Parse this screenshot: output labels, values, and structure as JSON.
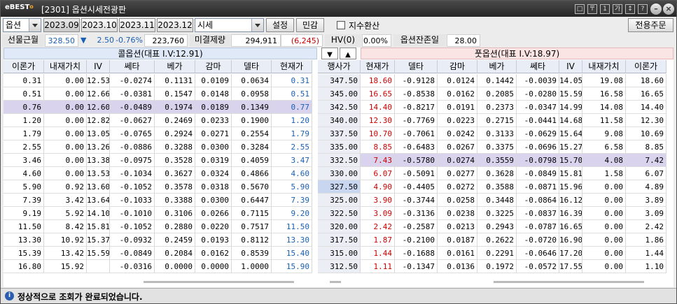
{
  "window": {
    "logo": "eBEST",
    "logo_mark": "o",
    "title": "[2301] 옵션시세전광판"
  },
  "title_buttons": [
    "□",
    "〒",
    "1",
    "가",
    "↕",
    "?"
  ],
  "toolbar": {
    "product_value": "옵션",
    "months": [
      "2023.09",
      "2023.10",
      "2023.11",
      "2023.12"
    ],
    "selected_month": "2023.09",
    "type_value": "시세",
    "settings_label": "설정",
    "sensitivity_label": "민감",
    "index_convert_label": "지수환산",
    "index_convert_checked": false,
    "order_label": "전용주문"
  },
  "info": {
    "futures_label": "선물근월",
    "futures_price": "328.50",
    "futures_arrow": "▼",
    "futures_change": "2.50",
    "futures_rate": "-0.76%",
    "futures_volume": "223,760",
    "oi_label": "미결제량",
    "oi_value": "294,911",
    "oi_change": "(6,245)",
    "hv_label": "HV(0)",
    "hv_value": "0.00%",
    "days_label": "옵션잔존일",
    "days_value": "28.00"
  },
  "colors": {
    "call_up": "#1a5fb4",
    "put_up": "#cc0000",
    "atm_highlight": "#d9d3ee",
    "atm_strike": "#c9d6f0"
  },
  "call": {
    "header": "콜옵션(대표 I.V:12.91)",
    "columns": [
      "이론가",
      "내재가치",
      "IV",
      "쎄타",
      "베가",
      "감마",
      "델타",
      "현재가"
    ]
  },
  "put": {
    "header": "풋옵션(대표 I.V:18.97)",
    "columns": [
      "현재가",
      "델타",
      "감마",
      "베가",
      "쎄타",
      "IV",
      "내재가치",
      "이론가"
    ]
  },
  "strike_header": "행사가",
  "rows": [
    {
      "c": [
        "0.31",
        "0.00",
        "12.53",
        "-0.0274",
        "0.1131",
        "0.0109",
        "0.0634",
        "0.31"
      ],
      "k": "347.50",
      "p": [
        "18.60",
        "-0.9128",
        "0.0124",
        "0.1442",
        "-0.0039",
        "14.05",
        "19.08",
        "18.60"
      ]
    },
    {
      "c": [
        "0.51",
        "0.00",
        "12.66",
        "-0.0381",
        "0.1547",
        "0.0148",
        "0.0958",
        "0.51"
      ],
      "k": "345.00",
      "p": [
        "16.65",
        "-0.8538",
        "0.0162",
        "0.2085",
        "-0.0280",
        "15.59",
        "16.58",
        "16.65"
      ]
    },
    {
      "c": [
        "0.76",
        "0.00",
        "12.60",
        "-0.0489",
        "0.1974",
        "0.0189",
        "0.1349",
        "0.77"
      ],
      "k": "342.50",
      "p": [
        "14.40",
        "-0.8217",
        "0.0191",
        "0.2373",
        "-0.0347",
        "14.99",
        "14.08",
        "14.40"
      ],
      "call_hl": true
    },
    {
      "c": [
        "1.20",
        "0.00",
        "12.82",
        "-0.0627",
        "0.2469",
        "0.0233",
        "0.1900",
        "1.20"
      ],
      "k": "340.00",
      "p": [
        "12.30",
        "-0.7769",
        "0.0223",
        "0.2715",
        "-0.0441",
        "14.68",
        "11.58",
        "12.30"
      ]
    },
    {
      "c": [
        "1.79",
        "0.00",
        "13.05",
        "-0.0765",
        "0.2924",
        "0.0271",
        "0.2554",
        "1.79"
      ],
      "k": "337.50",
      "p": [
        "10.70",
        "-0.7061",
        "0.0242",
        "0.3133",
        "-0.0629",
        "15.64",
        "9.08",
        "10.69"
      ]
    },
    {
      "c": [
        "2.55",
        "0.00",
        "13.26",
        "-0.0886",
        "0.3288",
        "0.0300",
        "0.3284",
        "2.55"
      ],
      "k": "335.00",
      "p": [
        "8.85",
        "-0.6483",
        "0.0267",
        "0.3375",
        "-0.0696",
        "15.27",
        "6.58",
        "8.85"
      ]
    },
    {
      "c": [
        "3.46",
        "0.00",
        "13.38",
        "-0.0975",
        "0.3528",
        "0.0319",
        "0.4059",
        "3.47"
      ],
      "k": "332.50",
      "p": [
        "7.43",
        "-0.5780",
        "0.0274",
        "0.3559",
        "-0.0798",
        "15.70",
        "4.08",
        "7.42"
      ],
      "put_hl": true
    },
    {
      "c": [
        "4.60",
        "0.00",
        "13.53",
        "-0.1034",
        "0.3627",
        "0.0324",
        "0.4866",
        "4.60"
      ],
      "k": "330.00",
      "p": [
        "6.07",
        "-0.5091",
        "0.0277",
        "0.3628",
        "-0.0849",
        "15.81",
        "1.58",
        "6.07"
      ]
    },
    {
      "c": [
        "5.90",
        "0.92",
        "13.60",
        "-0.1052",
        "0.3578",
        "0.0318",
        "0.5670",
        "5.90"
      ],
      "k": "327.50",
      "p": [
        "4.90",
        "-0.4405",
        "0.0272",
        "0.3588",
        "-0.0871",
        "15.96",
        "0.00",
        "4.89"
      ],
      "atm": true
    },
    {
      "c": [
        "7.39",
        "3.42",
        "13.64",
        "-0.1033",
        "0.3388",
        "0.0300",
        "0.6447",
        "7.39"
      ],
      "k": "325.00",
      "p": [
        "3.90",
        "-0.3744",
        "0.0258",
        "0.3448",
        "-0.0864",
        "16.12",
        "0.00",
        "3.89"
      ]
    },
    {
      "c": [
        "9.19",
        "5.92",
        "14.10",
        "-0.1010",
        "0.3106",
        "0.0266",
        "0.7115",
        "9.20"
      ],
      "k": "322.50",
      "p": [
        "3.09",
        "-0.3136",
        "0.0238",
        "0.3225",
        "-0.0837",
        "16.39",
        "0.00",
        "3.09"
      ]
    },
    {
      "c": [
        "11.50",
        "8.42",
        "15.81",
        "-0.1052",
        "0.2880",
        "0.0220",
        "0.7517",
        "11.50"
      ],
      "k": "320.00",
      "p": [
        "2.42",
        "-0.2587",
        "0.0213",
        "0.2943",
        "-0.0787",
        "16.65",
        "0.00",
        "2.42"
      ]
    },
    {
      "c": [
        "13.30",
        "10.92",
        "15.37",
        "-0.0932",
        "0.2459",
        "0.0193",
        "0.8112",
        "13.30"
      ],
      "k": "317.50",
      "p": [
        "1.87",
        "-0.2100",
        "0.0187",
        "0.2622",
        "-0.0720",
        "16.90",
        "0.00",
        "1.86"
      ]
    },
    {
      "c": [
        "15.39",
        "13.42",
        "15.59",
        "-0.0849",
        "0.2084",
        "0.0162",
        "0.8539",
        "15.40"
      ],
      "k": "315.00",
      "p": [
        "1.44",
        "-0.1688",
        "0.0161",
        "0.2291",
        "-0.0646",
        "17.20",
        "0.00",
        "1.44"
      ]
    },
    {
      "c": [
        "16.80",
        "15.92",
        "",
        "-0.0316",
        "0.0000",
        "0.0000",
        "1.0000",
        "15.90"
      ],
      "k": "312.50",
      "p": [
        "1.11",
        "-0.1347",
        "0.0136",
        "0.1972",
        "-0.0572",
        "17.55",
        "0.00",
        "1.10"
      ]
    }
  ],
  "status": {
    "icon": "i",
    "text": "정상적으로 조회가 완료되었습니다."
  }
}
